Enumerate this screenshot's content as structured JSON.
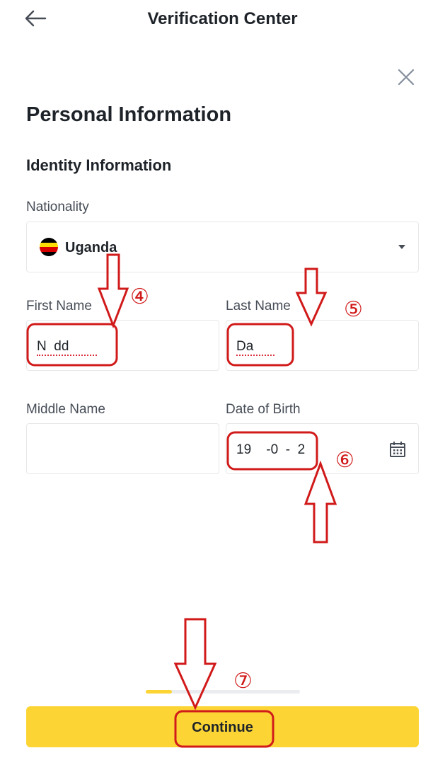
{
  "header": {
    "title": "Verification Center",
    "back_icon": "back-arrow-icon",
    "close_icon": "close-icon"
  },
  "section": {
    "title": "Personal Information",
    "subtitle": "Identity Information"
  },
  "nationality": {
    "label": "Nationality",
    "value": "Uganda",
    "flag_icon": "uganda-flag-icon"
  },
  "first_name": {
    "label": "First Name",
    "value": "N  dd"
  },
  "last_name": {
    "label": "Last Name",
    "value": "Da"
  },
  "middle_name": {
    "label": "Middle Name",
    "value": ""
  },
  "date_of_birth": {
    "label": "Date of Birth",
    "value": "19    -0  -  2",
    "calendar_icon": "calendar-icon"
  },
  "progress": {
    "fraction": 0.17
  },
  "footer": {
    "continue_label": "Continue"
  },
  "annotations": {
    "step4": "④",
    "step5": "⑤",
    "step6": "⑥",
    "step7": "⑦"
  },
  "colors": {
    "accent": "#FCD535",
    "annotation_red": "#D11A1A",
    "text": "#1E2329"
  }
}
